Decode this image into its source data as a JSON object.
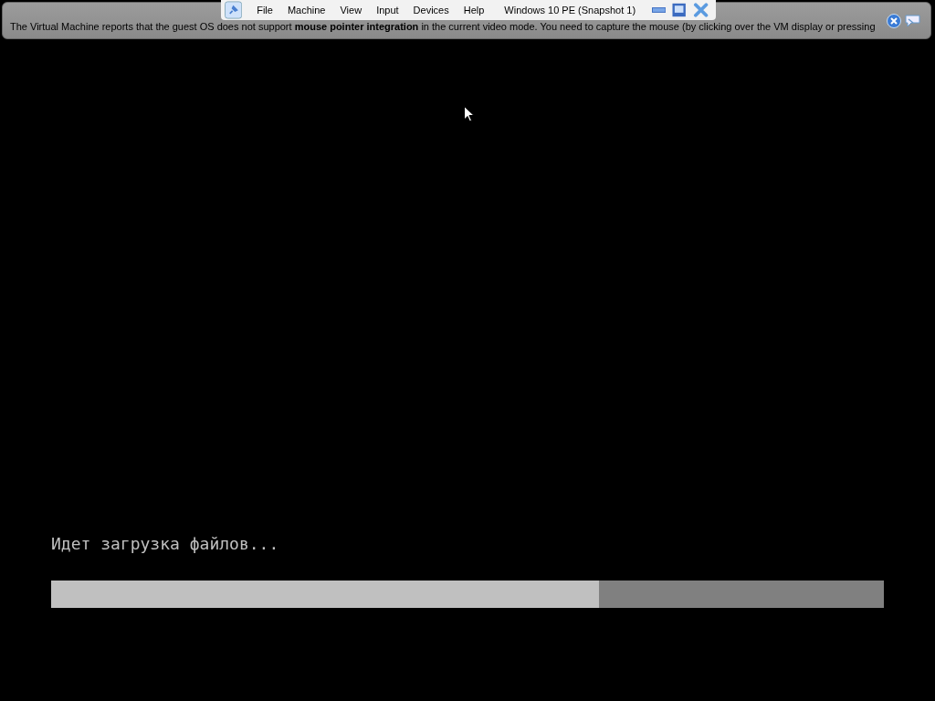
{
  "notification": {
    "message": "The Virtual Machine reports that the guest OS does not support **mouse pointer integration** in the current video mode. You need to capture the mouse (by clicking over the VM display or pressing"
  },
  "toolbar": {
    "menus": [
      "File",
      "Machine",
      "View",
      "Input",
      "Devices",
      "Help"
    ],
    "title": "Windows 10 PE (Snapshot 1)"
  },
  "screen": {
    "status": "Идет загрузка файлов...",
    "progress": {
      "level": 0.658
    }
  }
}
